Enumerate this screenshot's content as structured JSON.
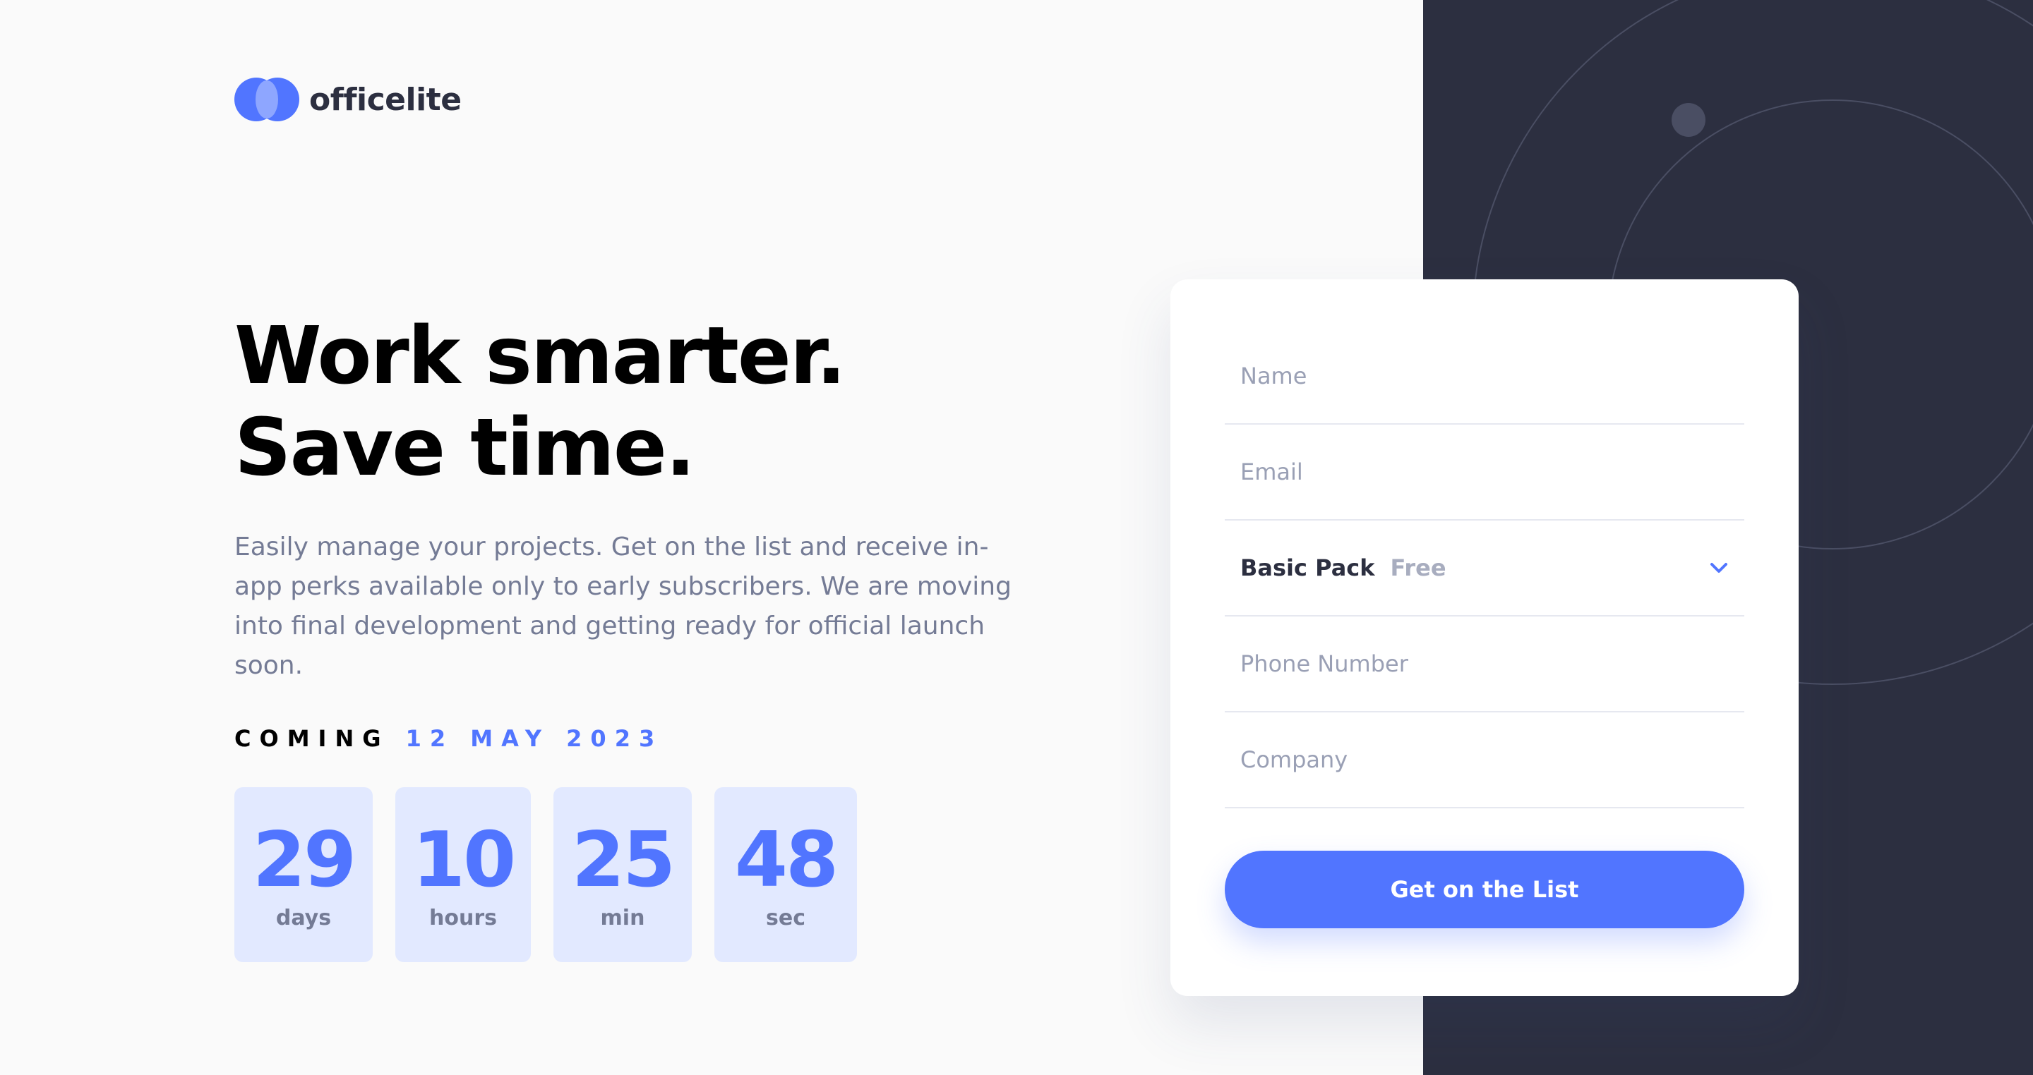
{
  "brand": {
    "name": "officelite",
    "accent": "#5175ff",
    "dark": "#2c2f40"
  },
  "hero": {
    "title": "Work smarter. Save time.",
    "description": "Easily manage your projects. Get on the list and receive in-app perks available only to early subscribers. We are moving into final development and getting ready for official launch soon."
  },
  "launch": {
    "coming_label": "COMING",
    "date": "12 MAY 2023"
  },
  "countdown": [
    {
      "value": "29",
      "unit": "days"
    },
    {
      "value": "10",
      "unit": "hours"
    },
    {
      "value": "25",
      "unit": "min"
    },
    {
      "value": "48",
      "unit": "sec"
    }
  ],
  "form": {
    "name_placeholder": "Name",
    "email_placeholder": "Email",
    "pack": {
      "name": "Basic Pack",
      "price": "Free",
      "icon": "chevron-down-icon"
    },
    "phone_placeholder": "Phone Number",
    "company_placeholder": "Company",
    "submit_label": "Get on the List"
  }
}
